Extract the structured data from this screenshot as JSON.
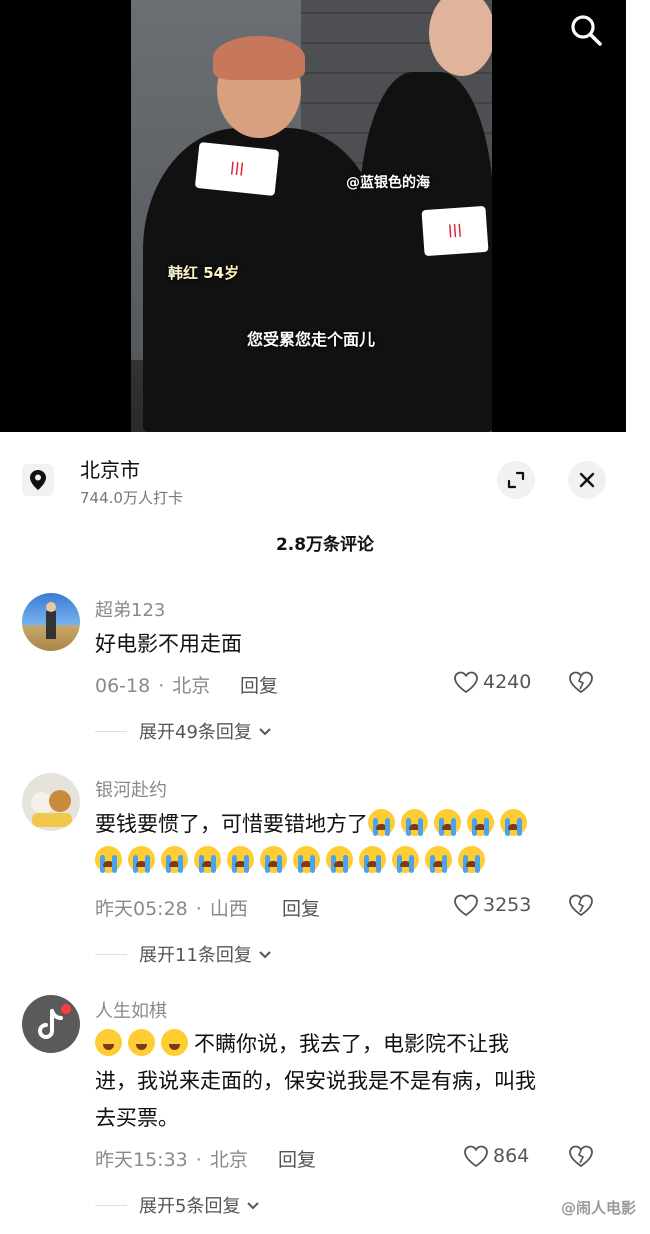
{
  "video": {
    "watermark_text": "@蓝银色的海",
    "caption_name": "韩红 54岁",
    "subtitle": "您受累您走个面儿"
  },
  "location": {
    "name": "北京市",
    "checkins": "744.0万人打卡"
  },
  "comments_header": {
    "count_label": "2.8万条评论"
  },
  "comments": [
    {
      "username": "超弟123",
      "text": "好电影不用走面",
      "date": "06-18",
      "region": "北京",
      "reply_label": "回复",
      "likes": "4240",
      "expand_label": "展开49条回复"
    },
    {
      "username": "银河赴约",
      "text": "要钱要惯了，可惜要错地方了",
      "date": "昨天05:28",
      "region": "山西",
      "reply_label": "回复",
      "likes": "3253",
      "expand_label": "展开11条回复"
    },
    {
      "username": "人生如棋",
      "text_line1": "不瞒你说，我去了，电影院不让我",
      "text_line2": "进，我说来走面的，保安说我是不是有病，叫我",
      "text_line3": "去买票。",
      "date": "昨天15:33",
      "region": "北京",
      "reply_label": "回复",
      "likes": "864",
      "expand_label": "展开5条回复"
    }
  ],
  "watermark": "@闹人电影",
  "icons": {
    "search": "search-icon",
    "pin": "location-pin-icon",
    "expand": "expand-icon",
    "close": "close-icon",
    "like": "heart-icon",
    "dislike": "broken-heart-icon",
    "chevron": "chevron-down-icon"
  }
}
